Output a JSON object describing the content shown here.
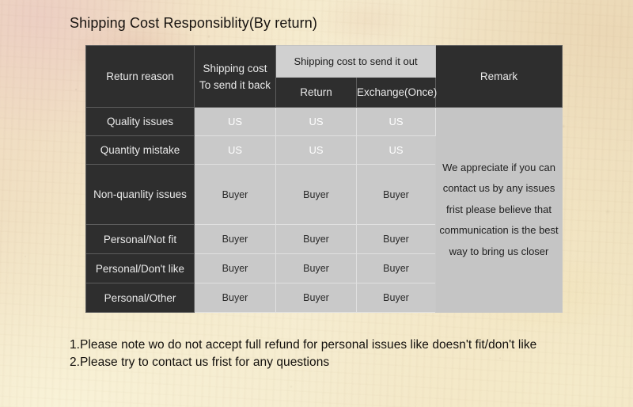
{
  "title": "Shipping Cost Responsiblity(By return)",
  "table": {
    "headers": {
      "return_reason": "Return reason",
      "shipping_cost_back_line1": "Shipping cost",
      "shipping_cost_back_line2": "To send it back",
      "shipping_cost_out": "Shipping cost to send it out",
      "sub_return": "Return",
      "sub_exchange": "Exchange(Once)",
      "remark": "Remark"
    },
    "rows": [
      {
        "reason": "Quality issues",
        "send_back": "US",
        "return": "US",
        "exchange": "US"
      },
      {
        "reason": "Quantity mistake",
        "send_back": "US",
        "return": "US",
        "exchange": "US"
      },
      {
        "reason": "Non-quanlity issues",
        "send_back": "Buyer",
        "return": "Buyer",
        "exchange": "Buyer"
      },
      {
        "reason": "Personal/Not fit",
        "send_back": "Buyer",
        "return": "Buyer",
        "exchange": "Buyer"
      },
      {
        "reason": "Personal/Don't like",
        "send_back": "Buyer",
        "return": "Buyer",
        "exchange": "Buyer"
      },
      {
        "reason": "Personal/Other",
        "send_back": "Buyer",
        "return": "Buyer",
        "exchange": "Buyer"
      }
    ],
    "remark_text": "We appreciate if you can contact us by any issues frist please believe that communication is the best way to bring us closer"
  },
  "notes": {
    "note1": "1.Please note wo do not accept full refund for personal issues like doesn't fit/don't like",
    "note2": "2.Please try to contact us frist for any questions"
  },
  "colors": {
    "page_background": "#f2e6c8",
    "header_dark": "#2e2e2e",
    "header_light": "#d0d0d0",
    "cell_gray": "#c9c9c9",
    "remark_gray": "#c5c5c5",
    "text_dark": "#171310",
    "text_light": "#e9e9e9"
  }
}
